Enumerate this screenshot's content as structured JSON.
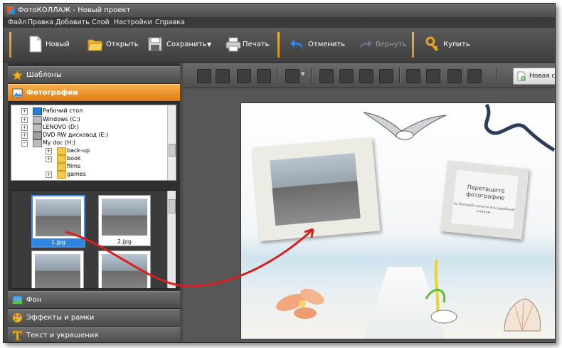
{
  "window": {
    "title": "ФотоКОЛЛАЖ - Новый проект"
  },
  "menu": [
    "Файл",
    "Правка",
    "Добавить",
    "Слой",
    "Настройки",
    "Справка"
  ],
  "toolbar": {
    "new_label": "Новый",
    "open_label": "Открыть",
    "save_label": "Сохранить",
    "print_label": "Печать",
    "undo_label": "Отменить",
    "redo_label": "Вернуть",
    "buy_label": "Купить"
  },
  "left_panel": {
    "templates_label": "Шаблоны",
    "photos_label": "Фотографии",
    "bg_label": "Фон",
    "effects_label": "Эффекты и рамки",
    "text_label": "Текст и украшения"
  },
  "tree": [
    {
      "label": "Рабочий стол",
      "icon": "desktop-icon"
    },
    {
      "label": "Windows (C:)",
      "icon": "drive-icon"
    },
    {
      "label": "LENOVO (D:)",
      "icon": "drive-icon"
    },
    {
      "label": "DVD RW дисковод (E:)",
      "icon": "dvd-icon"
    },
    {
      "label": "My doc (H:)",
      "icon": "drive-icon"
    },
    {
      "label": "back-up",
      "icon": "folder-icon"
    },
    {
      "label": "book",
      "icon": "folder-icon"
    },
    {
      "label": "films",
      "icon": "folder-icon"
    },
    {
      "label": "games",
      "icon": "folder-icon"
    }
  ],
  "thumbnails": [
    {
      "caption": "1.jpg",
      "selected": true
    },
    {
      "caption": "2.jpg",
      "selected": false
    },
    {
      "caption": "",
      "selected": false
    },
    {
      "caption": "",
      "selected": false
    }
  ],
  "editor": {
    "new_page_label": "Новая с"
  },
  "canvas": {
    "placeholder_title": "Перетащите фотографию",
    "placeholder_sub": "из боковой панели или двойным кликом"
  },
  "colors": {
    "accent": "#e8861a",
    "selection": "#2f86e0",
    "arrow": "#d42020"
  }
}
